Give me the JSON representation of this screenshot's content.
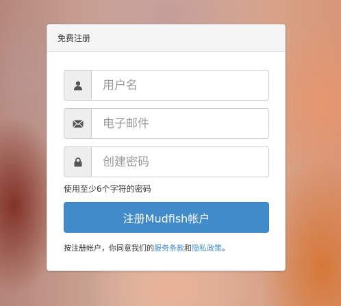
{
  "form": {
    "title": "免费注册",
    "username_placeholder": "用户名",
    "email_placeholder": "电子邮件",
    "password_placeholder": "创建密码",
    "password_hint": "使用至少6个字符的密码",
    "submit_label": "注册Mudfish帐户",
    "terms_prefix": "按注册帐户，你同意我们的",
    "terms_of_service_link": "服务条款",
    "terms_joiner": "和",
    "privacy_policy_link": "隐私政策",
    "terms_suffix": "。"
  },
  "icons": {
    "username": "user-icon",
    "email": "envelope-icon",
    "password": "lock-icon"
  },
  "colors": {
    "primary_button": "#428bca",
    "link": "#428bca"
  }
}
